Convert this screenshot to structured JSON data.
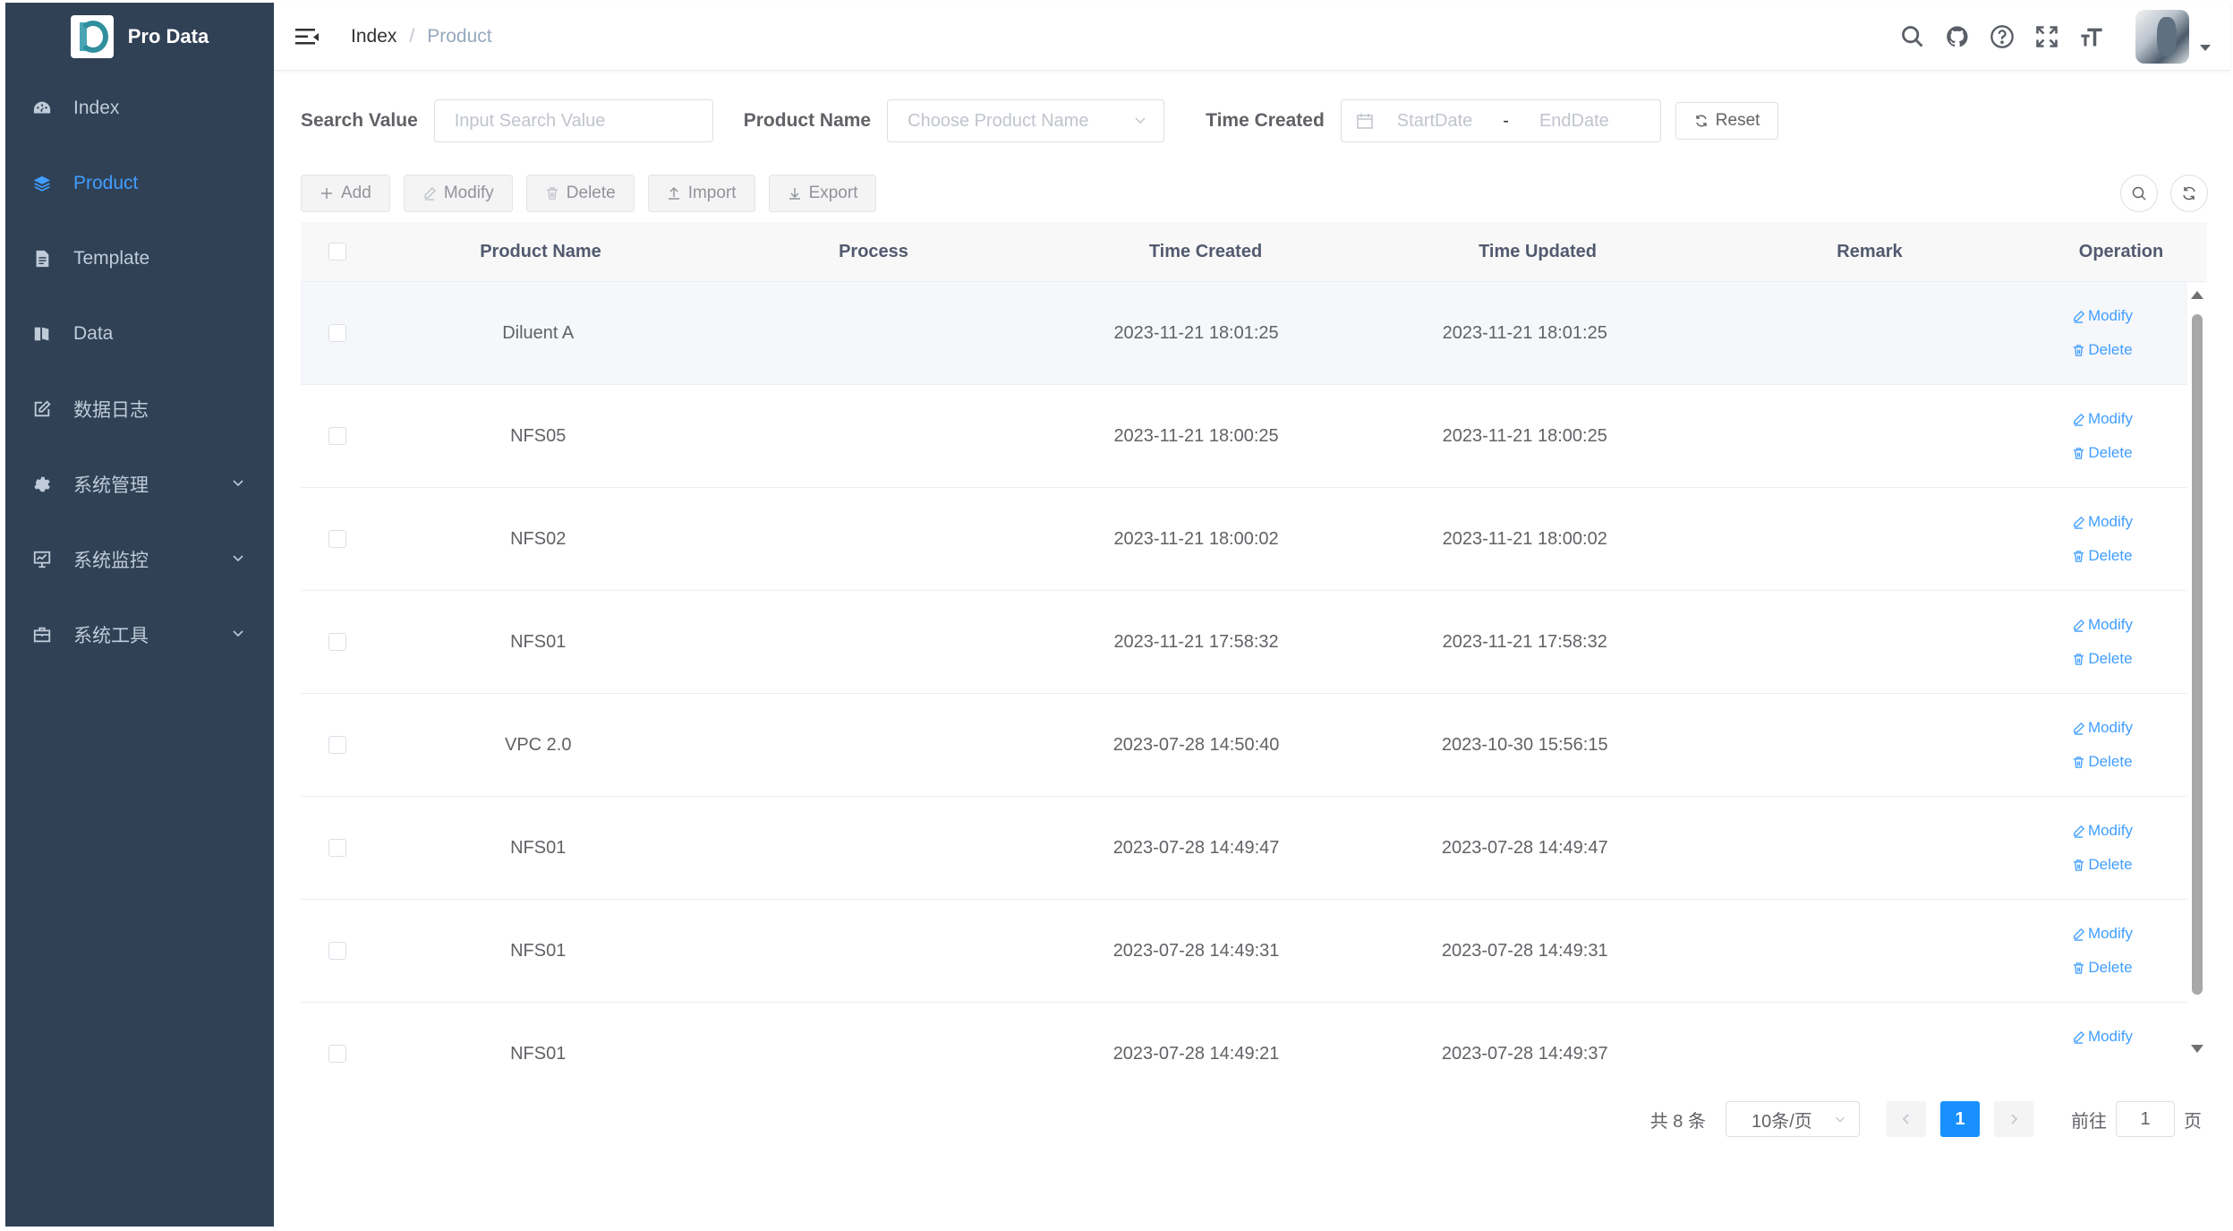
{
  "app": {
    "title": "Pro Data"
  },
  "colors": {
    "sidebar_bg": "#304156",
    "accent": "#409eff",
    "primary": "#1890ff"
  },
  "sidebar": {
    "items": [
      {
        "label": "Index",
        "icon": "dashboard-icon",
        "active": false
      },
      {
        "label": "Product",
        "icon": "layers-icon",
        "active": true
      },
      {
        "label": "Template",
        "icon": "document-icon",
        "active": false
      },
      {
        "label": "Data",
        "icon": "book-icon",
        "active": false
      },
      {
        "label": "数据日志",
        "icon": "edit-icon",
        "active": false
      },
      {
        "label": "系统管理",
        "icon": "gear-icon",
        "active": false,
        "expandable": true
      },
      {
        "label": "系统监控",
        "icon": "monitor-icon",
        "active": false,
        "expandable": true
      },
      {
        "label": "系统工具",
        "icon": "toolbox-icon",
        "active": false,
        "expandable": true
      }
    ]
  },
  "header": {
    "breadcrumb": {
      "home": "Index",
      "separator": "/",
      "current": "Product"
    },
    "tools": [
      "search-icon",
      "github-icon",
      "help-icon",
      "fullscreen-icon",
      "font-size-icon"
    ]
  },
  "search": {
    "value_label": "Search Value",
    "value_placeholder": "Input Search Value",
    "product_label": "Product Name",
    "product_placeholder": "Choose Product Name",
    "time_label": "Time Created",
    "start_placeholder": "StartDate",
    "date_separator": "-",
    "end_placeholder": "EndDate",
    "reset_label": "Reset"
  },
  "toolbar": {
    "add_label": "Add",
    "modify_label": "Modify",
    "delete_label": "Delete",
    "import_label": "Import",
    "export_label": "Export"
  },
  "table": {
    "columns": [
      "Product Name",
      "Process",
      "Time Created",
      "Time Updated",
      "Remark",
      "Operation"
    ],
    "modify_label": "Modify",
    "delete_label": "Delete",
    "rows": [
      {
        "name": "Diluent A",
        "process": "",
        "created": "2023-11-21 18:01:25",
        "updated": "2023-11-21 18:01:25",
        "remark": ""
      },
      {
        "name": "NFS05",
        "process": "",
        "created": "2023-11-21 18:00:25",
        "updated": "2023-11-21 18:00:25",
        "remark": ""
      },
      {
        "name": "NFS02",
        "process": "",
        "created": "2023-11-21 18:00:02",
        "updated": "2023-11-21 18:00:02",
        "remark": ""
      },
      {
        "name": "NFS01",
        "process": "",
        "created": "2023-11-21 17:58:32",
        "updated": "2023-11-21 17:58:32",
        "remark": ""
      },
      {
        "name": "VPC 2.0",
        "process": "",
        "created": "2023-07-28 14:50:40",
        "updated": "2023-10-30 15:56:15",
        "remark": ""
      },
      {
        "name": "NFS01",
        "process": "",
        "created": "2023-07-28 14:49:47",
        "updated": "2023-07-28 14:49:47",
        "remark": ""
      },
      {
        "name": "NFS01",
        "process": "",
        "created": "2023-07-28 14:49:31",
        "updated": "2023-07-28 14:49:31",
        "remark": ""
      },
      {
        "name": "NFS01",
        "process": "",
        "created": "2023-07-28 14:49:21",
        "updated": "2023-07-28 14:49:37",
        "remark": ""
      }
    ]
  },
  "pagination": {
    "total_text": "共 8 条",
    "page_size": "10条/页",
    "current_page": "1",
    "goto_prefix": "前往",
    "goto_value": "1",
    "goto_suffix": "页"
  }
}
